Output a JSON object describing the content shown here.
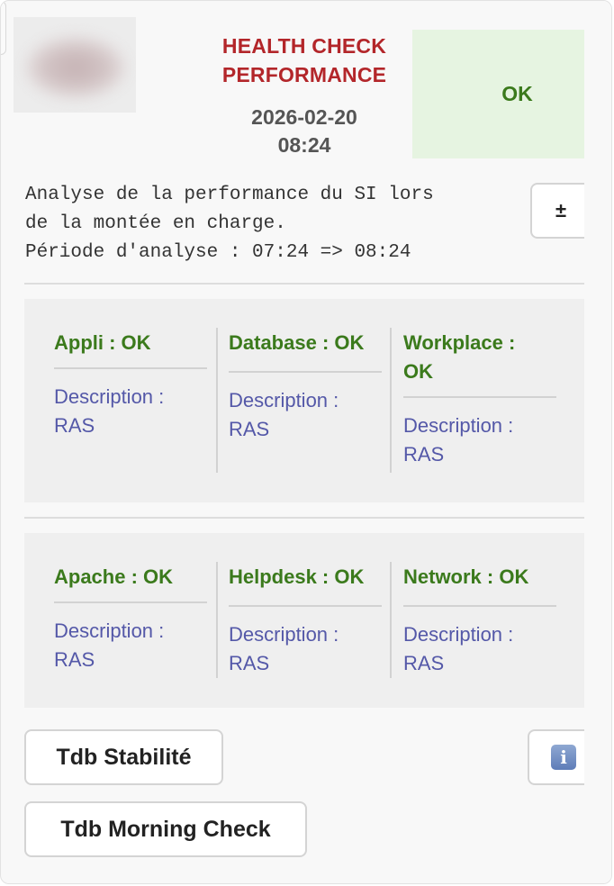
{
  "header": {
    "title_line1": "HEALTH CHECK",
    "title_line2": "PERFORMANCE",
    "date": "2026-02-20",
    "time": "08:24",
    "status": "OK"
  },
  "description": {
    "line1": "Analyse de la performance du SI lors",
    "line2": "de la montée en charge.",
    "line3": "Période d'analyse : 07:24 => 08:24",
    "toggle_label": "±"
  },
  "panels": [
    {
      "items": [
        {
          "name": "Appli : OK",
          "desc": "Description : RAS"
        },
        {
          "name": "Database : OK",
          "desc": "Description : RAS"
        },
        {
          "name": "Workplace : OK",
          "desc": "Description : RAS"
        }
      ]
    },
    {
      "items": [
        {
          "name": "Apache : OK",
          "desc": "Description : RAS"
        },
        {
          "name": "Helpdesk : OK",
          "desc": "Description : RAS"
        },
        {
          "name": "Network : OK",
          "desc": "Description : RAS"
        }
      ]
    }
  ],
  "buttons": {
    "stability": "Tdb Stabilité",
    "morning_check": "Tdb Morning Check",
    "info_icon": "info-icon"
  },
  "colors": {
    "title": "#b3262a",
    "ok": "#3b7a1c",
    "ok_bg": "#e6f4e1",
    "description": "#5458a8"
  }
}
